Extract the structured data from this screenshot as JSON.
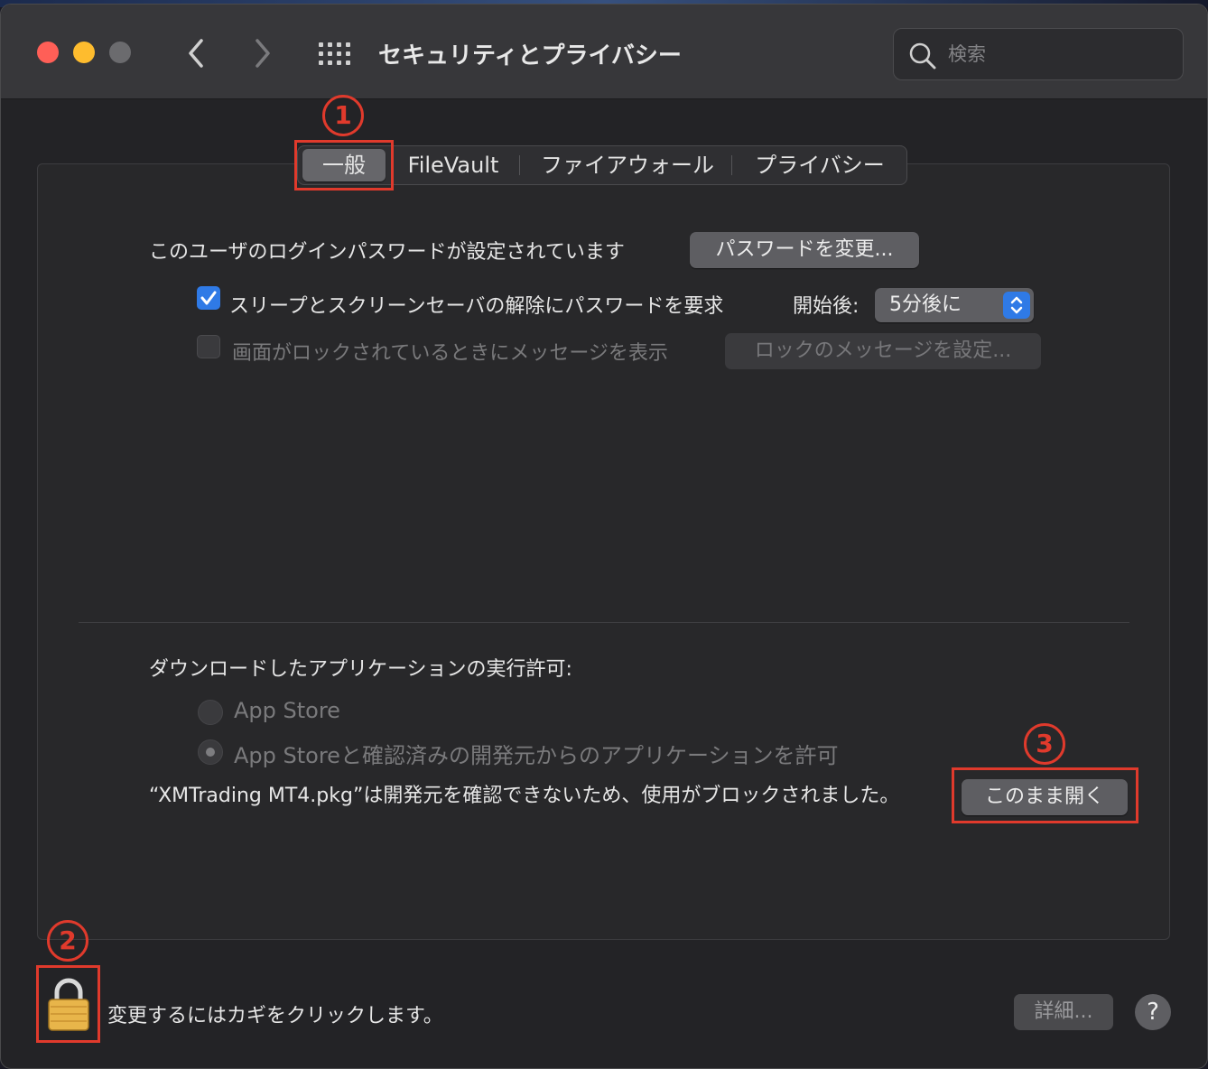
{
  "window": {
    "title": "セキュリティとプライバシー",
    "search_placeholder": "検索"
  },
  "colors": {
    "close": "#ff5f57",
    "minimize": "#febc2e",
    "zoom": "#6b6b6e",
    "accent": "#2f7ae6",
    "annotation": "#e03a2c"
  },
  "tabs": [
    {
      "label": "一般",
      "active": true
    },
    {
      "label": "FileVault",
      "active": false
    },
    {
      "label": "ファイアウォール",
      "active": false
    },
    {
      "label": "プライバシー",
      "active": false
    }
  ],
  "general": {
    "password_label": "このユーザのログインパスワードが設定されています",
    "change_password_button": "パスワードを変更...",
    "require_password_label": "スリープとスクリーンセーバの解除にパスワードを要求",
    "require_password_checked": true,
    "delay_label": "開始後:",
    "delay_value": "5分後に",
    "show_message_label": "画面がロックされているときにメッセージを表示",
    "show_message_checked": false,
    "set_lock_message_button": "ロックのメッセージを設定..."
  },
  "downloads": {
    "heading": "ダウンロードしたアプリケーションの実行許可:",
    "options": [
      {
        "label": "App Store",
        "selected": false
      },
      {
        "label": "App Storeと確認済みの開発元からのアプリケーションを許可",
        "selected": true
      }
    ],
    "blocked_message": "“XMTrading MT4.pkg”は開発元を確認できないため、使用がブロックされました。",
    "open_anyway_button": "このまま開く"
  },
  "footer": {
    "lock_label": "変更するにはカギをクリックします。",
    "advanced_button": "詳細...",
    "help_button": "?"
  },
  "annotations": [
    "1",
    "2",
    "3"
  ]
}
